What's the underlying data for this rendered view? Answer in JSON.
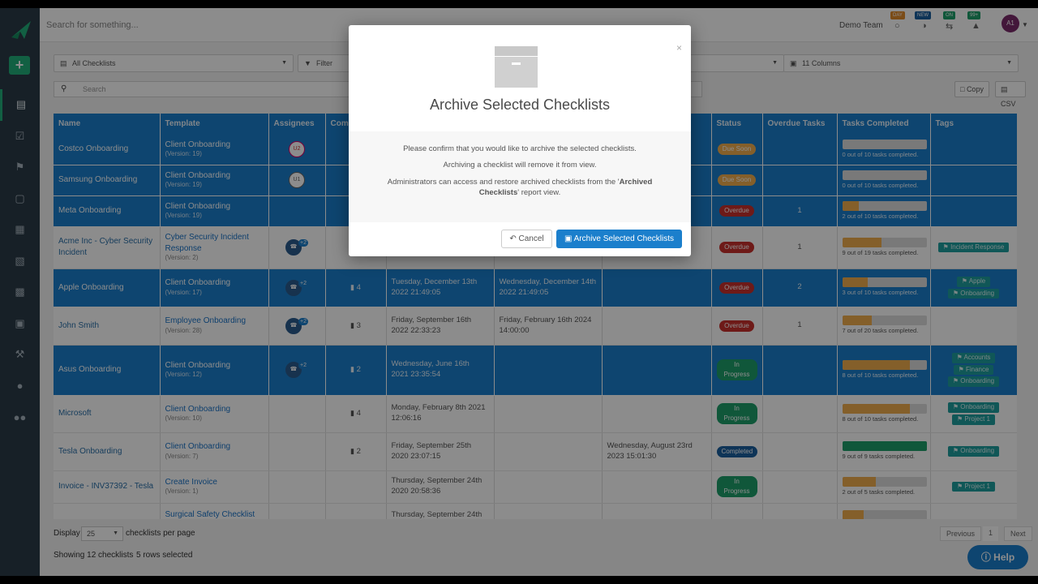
{
  "topbar": {
    "search_placeholder": "Search for something...",
    "team": "Demo Team",
    "badges": [
      "DAY",
      "NEW",
      "ON",
      "99+"
    ],
    "avatar": "A1"
  },
  "filters": {
    "checklists": "All Checklists",
    "filter": "Filter",
    "columns": "11 Columns"
  },
  "search": {
    "placeholder": "Search",
    "copy": "Copy",
    "csv": "CSV"
  },
  "table": {
    "headers": [
      "Name",
      "Template",
      "Assignees",
      "Comm",
      "",
      "",
      "",
      "Status",
      "Overdue Tasks",
      "Tasks Completed",
      "Tags"
    ],
    "rows": [
      {
        "name": "Costco Onboarding",
        "template": "Client Onboarding",
        "version": "(Version: 19)",
        "assignee": "U2",
        "comments": "",
        "created": "",
        "completed": "",
        "due": "",
        "status": "Due Soon",
        "overdue": "",
        "progress": 0,
        "tasks": "0 out of 10 tasks completed.",
        "tags": [],
        "selected": true
      },
      {
        "name": "Samsung Onboarding",
        "template": "Client Onboarding",
        "version": "(Version: 19)",
        "assignee": "U1",
        "comments": "",
        "created": "",
        "completed": "",
        "due": "",
        "status": "Due Soon",
        "overdue": "",
        "progress": 0,
        "tasks": "0 out of 10 tasks completed.",
        "tags": [],
        "selected": true
      },
      {
        "name": "Meta Onboarding",
        "template": "Client Onboarding",
        "version": "(Version: 19)",
        "assignee": "",
        "comments": "",
        "created": "",
        "completed": "",
        "due": "",
        "status": "Overdue",
        "overdue": "1",
        "progress": 0.2,
        "tasks": "2 out of 10 tasks completed.",
        "tags": [],
        "selected": true
      },
      {
        "name": "Acme Inc - Cyber Security Incident",
        "template": "Cyber Security Incident Response",
        "version": "(Version: 2)",
        "assignee": "+2",
        "comments": "",
        "created": "",
        "completed": "",
        "due": "",
        "status": "Overdue",
        "overdue": "1",
        "progress": 0.47,
        "tasks": "9 out of 19 tasks completed.",
        "tags": [
          "Incident Response"
        ],
        "selected": false
      },
      {
        "name": "Apple Onboarding",
        "template": "Client Onboarding",
        "version": "(Version: 17)",
        "assignee": "+2",
        "comments": "4",
        "created": "Tuesday, December 13th 2022 21:49:05",
        "completed": "Wednesday, December 14th 2022 21:49:05",
        "due": "",
        "status": "Overdue",
        "overdue": "2",
        "progress": 0.3,
        "tasks": "3 out of 10 tasks completed.",
        "tags": [
          "Apple",
          "Onboarding"
        ],
        "selected": true
      },
      {
        "name": "John Smith",
        "template": "Employee Onboarding",
        "version": "(Version: 28)",
        "assignee": "+2",
        "comments": "3",
        "created": "Friday, September 16th 2022 22:33:23",
        "completed": "Friday, February 16th 2024 14:00:00",
        "due": "",
        "status": "Overdue",
        "overdue": "1",
        "progress": 0.35,
        "tasks": "7 out of 20 tasks completed.",
        "tags": [],
        "selected": false
      },
      {
        "name": "Asus Onboarding",
        "template": "Client Onboarding",
        "version": "(Version: 12)",
        "assignee": "+2",
        "comments": "2",
        "created": "Wednesday, June 16th 2021 23:35:54",
        "completed": "",
        "due": "",
        "status": "In Progress",
        "overdue": "",
        "progress": 0.8,
        "tasks": "8 out of 10 tasks completed.",
        "tags": [
          "Accounts",
          "Finance",
          "Onboarding"
        ],
        "selected": true
      },
      {
        "name": "Microsoft",
        "template": "Client Onboarding",
        "version": "(Version: 10)",
        "assignee": "",
        "comments": "4",
        "created": "Monday, February 8th 2021 12:06:16",
        "completed": "",
        "due": "",
        "status": "In Progress",
        "overdue": "",
        "progress": 0.8,
        "tasks": "8 out of 10 tasks completed.",
        "tags": [
          "Onboarding",
          "Project 1"
        ],
        "selected": false
      },
      {
        "name": "Tesla Onboarding",
        "template": "Client Onboarding",
        "version": "(Version: 7)",
        "assignee": "",
        "comments": "2",
        "created": "Friday, September 25th 2020 23:07:15",
        "completed": "",
        "due": "Wednesday, August 23rd 2023 15:01:30",
        "status": "Completed",
        "overdue": "",
        "progress": 1,
        "tasks": "9 out of 9 tasks completed.",
        "tags": [
          "Onboarding"
        ],
        "selected": false
      },
      {
        "name": "Invoice - INV37392 - Tesla",
        "template": "Create Invoice",
        "version": "(Version: 1)",
        "assignee": "",
        "comments": "",
        "created": "Thursday, September 24th 2020 20:58:36",
        "completed": "",
        "due": "",
        "status": "In Progress",
        "overdue": "",
        "progress": 0.4,
        "tasks": "2 out of 5 tasks completed.",
        "tags": [
          "Project 1"
        ],
        "selected": false
      },
      {
        "name": "",
        "template": "Surgical Safety Checklist",
        "version": "",
        "assignee": "",
        "comments": "",
        "created": "Thursday, September 24th",
        "completed": "",
        "due": "",
        "status": "",
        "overdue": "",
        "progress": 0.25,
        "tasks": "",
        "tags": [],
        "selected": false
      }
    ]
  },
  "footer": {
    "display": "Display",
    "page_size": "25",
    "per_page": "checklists per page",
    "showing": "Showing 12 checklists",
    "selected": "5 rows selected",
    "previous": "Previous",
    "page": "1",
    "next": "Next"
  },
  "help": "Help",
  "modal": {
    "title": "Archive Selected Checklists",
    "line1": "Please confirm that you would like to archive the selected checklists.",
    "line2": "Archiving a checklist will remove it from view.",
    "line3_a": "Administrators can access and restore archived checklists from the '",
    "line3_b": "Archived Checklists",
    "line3_c": "' report view.",
    "cancel": "Cancel",
    "confirm": "Archive Selected Checklists",
    "close": "×"
  },
  "colors": {
    "primary": "#1b7fcc",
    "sidebar": "#2b3b48",
    "green": "#21b07a",
    "overdue": "#c9302c",
    "due_soon": "#f0ad4e"
  }
}
